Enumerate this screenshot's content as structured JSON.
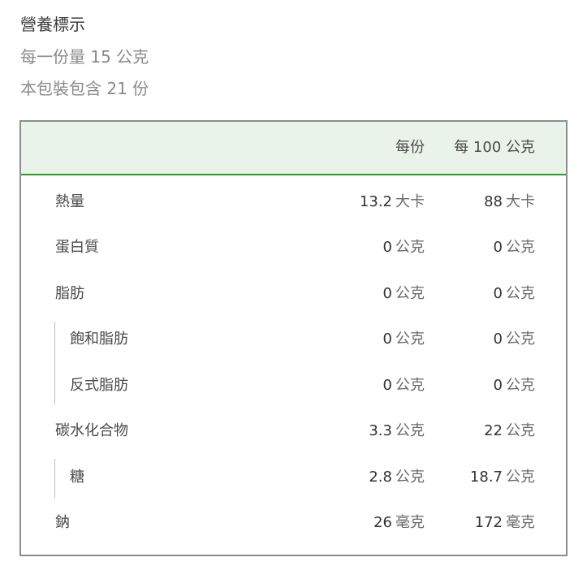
{
  "header": {
    "title": "營養標示",
    "serving_size": "每一份量 15 公克",
    "servings_per_package": "本包裝包含 21 份"
  },
  "table": {
    "columns": [
      "每份",
      "每 100 公克"
    ],
    "rows": [
      {
        "label": "熱量",
        "per_serving": {
          "value": "13.2",
          "unit": "大卡"
        },
        "per_100g": {
          "value": "88",
          "unit": "大卡"
        }
      },
      {
        "label": "蛋白質",
        "per_serving": {
          "value": "0",
          "unit": "公克"
        },
        "per_100g": {
          "value": "0",
          "unit": "公克"
        }
      },
      {
        "label": "脂肪",
        "per_serving": {
          "value": "0",
          "unit": "公克"
        },
        "per_100g": {
          "value": "0",
          "unit": "公克"
        }
      },
      {
        "label": "飽和脂肪",
        "per_serving": {
          "value": "0",
          "unit": "公克"
        },
        "per_100g": {
          "value": "0",
          "unit": "公克"
        }
      },
      {
        "label": "反式脂肪",
        "per_serving": {
          "value": "0",
          "unit": "公克"
        },
        "per_100g": {
          "value": "0",
          "unit": "公克"
        }
      },
      {
        "label": "碳水化合物",
        "per_serving": {
          "value": "3.3",
          "unit": "公克"
        },
        "per_100g": {
          "value": "22",
          "unit": "公克"
        }
      },
      {
        "label": "糖",
        "per_serving": {
          "value": "2.8",
          "unit": "公克"
        },
        "per_100g": {
          "value": "18.7",
          "unit": "公克"
        }
      },
      {
        "label": "鈉",
        "per_serving": {
          "value": "26",
          "unit": "毫克"
        },
        "per_100g": {
          "value": "172",
          "unit": "毫克"
        }
      }
    ]
  },
  "colors": {
    "header_bg": "#eaf3ea",
    "header_rule": "#3e8e3a",
    "border": "#8d8d8d"
  }
}
